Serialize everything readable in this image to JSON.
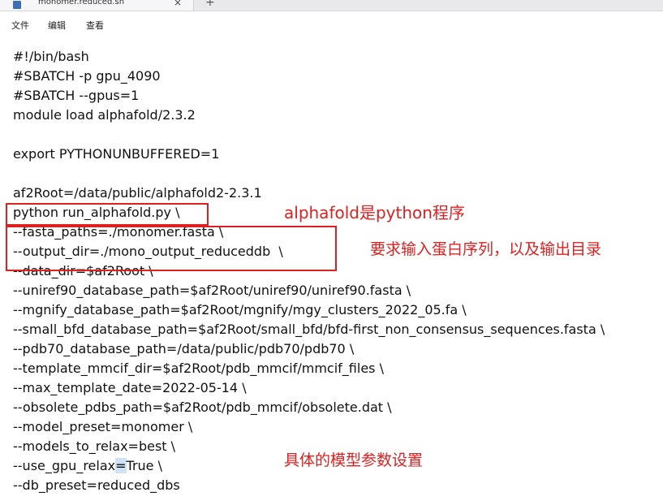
{
  "window": {
    "tab_title": "monomer.reduced.sh",
    "tab_close": "×",
    "tab_new": "+"
  },
  "menu": {
    "items": [
      "文件",
      "编辑",
      "查看"
    ]
  },
  "editor": {
    "lines": [
      "#!/bin/bash",
      "#SBATCH -p gpu_4090",
      "#SBATCH --gpus=1",
      "module load alphafold/2.3.2",
      "",
      "export PYTHONUNBUFFERED=1",
      "",
      "af2Root=/data/public/alphafold2-2.3.1",
      "python run_alphafold.py \\",
      "--fasta_paths=./monomer.fasta \\",
      "--output_dir=./mono_output_reduceddb  \\",
      "--data_dir=$af2Root \\",
      "--uniref90_database_path=$af2Root/uniref90/uniref90.fasta \\",
      "--mgnify_database_path=$af2Root/mgnify/mgy_clusters_2022_05.fa \\",
      "--small_bfd_database_path=$af2Root/small_bfd/bfd-first_non_consensus_sequences.fasta \\",
      "--pdb70_database_path=/data/public/pdb70/pdb70 \\",
      "--template_mmcif_dir=$af2Root/pdb_mmcif/mmcif_files \\",
      "--max_template_date=2022-05-14 \\",
      "--obsolete_pdbs_path=$af2Root/pdb_mmcif/obsolete.dat \\",
      "--model_preset=monomer \\",
      "--models_to_relax=best \\",
      "--use_gpu_relax",
      "--db_preset=reduced_dbs"
    ],
    "relax_eq": "=",
    "relax_value": "True \\"
  },
  "annotations": {
    "note1": "alphafold是python程序",
    "note2": "要求输入蛋白序列，以及输出目录",
    "note3": "具体的模型参数设置"
  },
  "colors": {
    "annotation": "#e02020",
    "selection": "#cfe2f7"
  }
}
